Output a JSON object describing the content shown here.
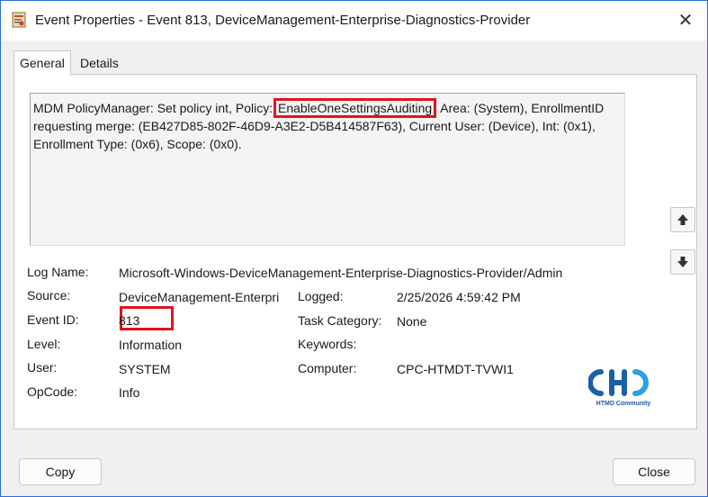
{
  "window": {
    "title": "Event Properties - Event 813, DeviceManagement-Enterprise-Diagnostics-Provider",
    "close_glyph": "✕",
    "app_icon": "event-viewer-icon"
  },
  "tabs": [
    {
      "label": "General",
      "selected": true
    },
    {
      "label": "Details",
      "selected": false
    }
  ],
  "description": {
    "part1": "MDM PolicyManager: Set policy int, Policy: ",
    "policy": "EnableOneSettingsAuditing",
    "part2": ", Area: (System), EnrollmentID requesting merge: (EB427D85-802F-46D9-A3E2-D5B414587F63), Current User: (Device), Int: (0x1), Enrollment Type: (0x6), Scope: (0x0)."
  },
  "nav": {
    "up_icon": "arrow-up-icon",
    "down_icon": "arrow-down-icon"
  },
  "fields": {
    "log_name": {
      "label": "Log Name:",
      "value": "Microsoft-Windows-DeviceManagement-Enterprise-Diagnostics-Provider/Admin"
    },
    "source": {
      "label": "Source:",
      "value": "DeviceManagement-Enterpri"
    },
    "logged": {
      "label": "Logged:",
      "value": "2/25/2026 4:59:42 PM"
    },
    "event_id": {
      "label": "Event ID:",
      "value": "813"
    },
    "task_category": {
      "label": "Task Category:",
      "value": "None"
    },
    "level": {
      "label": "Level:",
      "value": "Information"
    },
    "keywords": {
      "label": "Keywords:",
      "value": ""
    },
    "user": {
      "label": "User:",
      "value": "SYSTEM"
    },
    "computer": {
      "label": "Computer:",
      "value": "CPC-HTMDT-TVWI1"
    },
    "opcode": {
      "label": "OpCode:",
      "value": "Info"
    }
  },
  "logo": {
    "caption": "HTMD Community",
    "color": "#1b5fa8"
  },
  "buttons": {
    "copy": "Copy",
    "close": "Close"
  },
  "colors": {
    "highlight": "#e0141e",
    "border_accent": "#2b6cd8"
  }
}
